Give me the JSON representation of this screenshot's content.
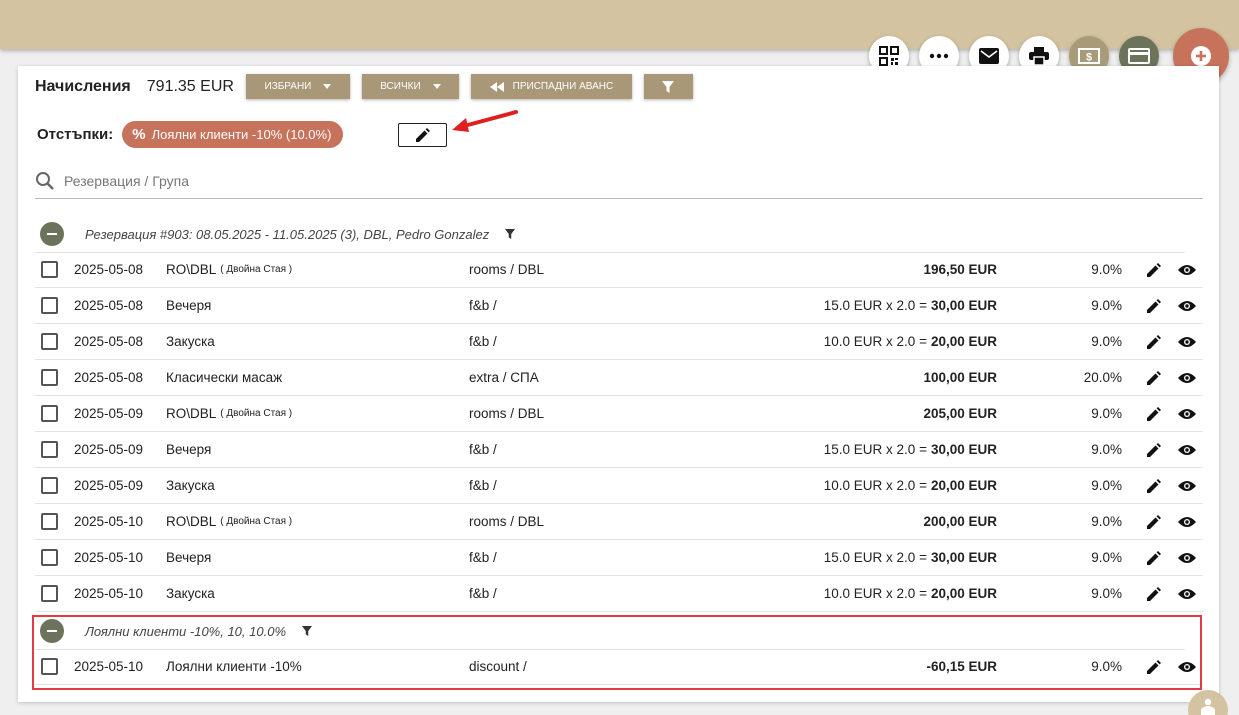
{
  "header": {
    "title": "Начисления",
    "total": "791.35 EUR",
    "btn_selected": "ИЗБРАНИ",
    "btn_all": "ВСИЧКИ",
    "btn_advance": "ПРИСПАДНИ АВАНС"
  },
  "discounts": {
    "label": "Отстъпки:",
    "chip": "Лоялни клиенти -10% (10.0%)"
  },
  "search": {
    "placeholder": "Резервация / Група"
  },
  "groups": [
    {
      "label": "Резервация #903: 08.05.2025 - 11.05.2025 (3), DBL, Pedro Gonzalez",
      "rows": [
        {
          "date": "2025-05-08",
          "name": "RO\\DBL",
          "note": "( Двойна Стая )",
          "category": "rooms / DBL",
          "qty": "",
          "amount": "196,50 EUR",
          "vat": "9.0%"
        },
        {
          "date": "2025-05-08",
          "name": "Вечеря",
          "note": "",
          "category": "f&b /",
          "qty": "15.0 EUR x 2.0 =",
          "amount": "30,00 EUR",
          "vat": "9.0%"
        },
        {
          "date": "2025-05-08",
          "name": "Закуска",
          "note": "",
          "category": "f&b /",
          "qty": "10.0 EUR x 2.0 =",
          "amount": "20,00 EUR",
          "vat": "9.0%"
        },
        {
          "date": "2025-05-08",
          "name": "Класически масаж",
          "note": "",
          "category": "extra / СПА",
          "qty": "",
          "amount": "100,00 EUR",
          "vat": "20.0%"
        },
        {
          "date": "2025-05-09",
          "name": "RO\\DBL",
          "note": "( Двойна Стая )",
          "category": "rooms / DBL",
          "qty": "",
          "amount": "205,00 EUR",
          "vat": "9.0%"
        },
        {
          "date": "2025-05-09",
          "name": "Вечеря",
          "note": "",
          "category": "f&b /",
          "qty": "15.0 EUR x 2.0 =",
          "amount": "30,00 EUR",
          "vat": "9.0%"
        },
        {
          "date": "2025-05-09",
          "name": "Закуска",
          "note": "",
          "category": "f&b /",
          "qty": "10.0 EUR x 2.0 =",
          "amount": "20,00 EUR",
          "vat": "9.0%"
        },
        {
          "date": "2025-05-10",
          "name": "RO\\DBL",
          "note": "( Двойна Стая )",
          "category": "rooms / DBL",
          "qty": "",
          "amount": "200,00 EUR",
          "vat": "9.0%"
        },
        {
          "date": "2025-05-10",
          "name": "Вечеря",
          "note": "",
          "category": "f&b /",
          "qty": "15.0 EUR x 2.0 =",
          "amount": "30,00 EUR",
          "vat": "9.0%"
        },
        {
          "date": "2025-05-10",
          "name": "Закуска",
          "note": "",
          "category": "f&b /",
          "qty": "10.0 EUR x 2.0 =",
          "amount": "20,00 EUR",
          "vat": "9.0%"
        }
      ]
    },
    {
      "label": "Лоялни клиенти -10%, 10, 10.0%",
      "rows": [
        {
          "date": "2025-05-10",
          "name": "Лоялни клиенти -10%",
          "note": "",
          "category": "discount /",
          "qty": "",
          "amount": "-60,15 EUR",
          "vat": "9.0%"
        }
      ]
    }
  ],
  "colors": {
    "accent": "#c7725a",
    "olive": "#6b735a",
    "tan": "#a99878",
    "highlight": "#e53945"
  }
}
